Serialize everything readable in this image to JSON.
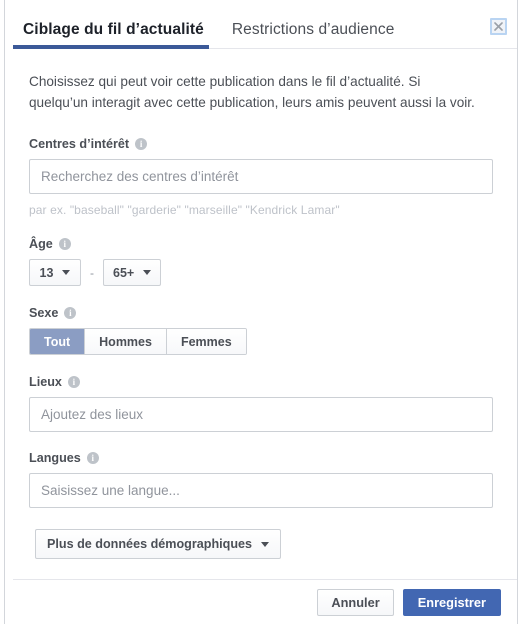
{
  "dialog": {
    "tabs": [
      {
        "label": "Ciblage du fil d’actualité",
        "active": true
      },
      {
        "label": "Restrictions d’audience",
        "active": false
      }
    ],
    "close_label": "✕",
    "intro": "Choisissez qui peut voir cette publication dans le fil d’actualité. Si quelqu’un interagit avec cette publication, leurs amis peuvent aussi la voir.",
    "fields": {
      "interests": {
        "label": "Centres d’intérêt",
        "info": "i",
        "placeholder": "Recherchez des centres d’intérêt",
        "value": "",
        "hint": "par ex. \"baseball\" \"garderie\" \"marseille\" \"Kendrick Lamar\""
      },
      "age": {
        "label": "Âge",
        "info": "i",
        "min": "13",
        "max": "65+",
        "separator": "-"
      },
      "gender": {
        "label": "Sexe",
        "info": "i",
        "options": [
          {
            "label": "Tout",
            "selected": true
          },
          {
            "label": "Hommes",
            "selected": false
          },
          {
            "label": "Femmes",
            "selected": false
          }
        ]
      },
      "locations": {
        "label": "Lieux",
        "info": "i",
        "placeholder": "Ajoutez des lieux",
        "value": ""
      },
      "languages": {
        "label": "Langues",
        "info": "i",
        "placeholder": "Saisissez une langue...",
        "value": ""
      }
    },
    "more_demographics_label": "Plus de données démographiques",
    "footer": {
      "cancel_label": "Annuler",
      "save_label": "Enregistrer"
    },
    "colors": {
      "accent": "#3b5998",
      "primary_button": "#4267b2",
      "selected_segment": "#8b9dc3",
      "border": "#ccd0d5",
      "text": "#4b4f56"
    }
  }
}
